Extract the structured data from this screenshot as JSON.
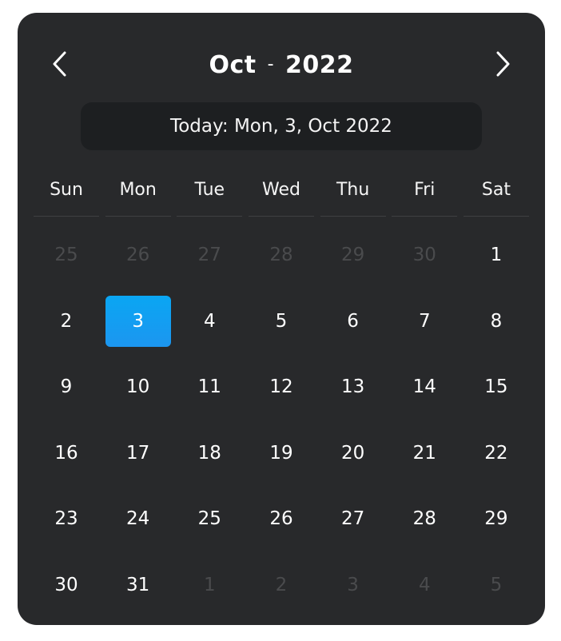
{
  "header": {
    "month": "Oct",
    "separator": "-",
    "year": "2022",
    "prev_icon": "chevron-left-icon",
    "next_icon": "chevron-right-icon"
  },
  "today_label": "Today: Mon, 3, Oct 2022",
  "weekdays": [
    "Sun",
    "Mon",
    "Tue",
    "Wed",
    "Thu",
    "Fri",
    "Sat"
  ],
  "days": [
    {
      "label": "25",
      "muted": true
    },
    {
      "label": "26",
      "muted": true
    },
    {
      "label": "27",
      "muted": true
    },
    {
      "label": "28",
      "muted": true
    },
    {
      "label": "29",
      "muted": true
    },
    {
      "label": "30",
      "muted": true
    },
    {
      "label": "1"
    },
    {
      "label": "2"
    },
    {
      "label": "3",
      "selected": true
    },
    {
      "label": "4"
    },
    {
      "label": "5"
    },
    {
      "label": "6"
    },
    {
      "label": "7"
    },
    {
      "label": "8"
    },
    {
      "label": "9"
    },
    {
      "label": "10"
    },
    {
      "label": "11"
    },
    {
      "label": "12"
    },
    {
      "label": "13"
    },
    {
      "label": "14"
    },
    {
      "label": "15"
    },
    {
      "label": "16"
    },
    {
      "label": "17"
    },
    {
      "label": "18"
    },
    {
      "label": "19"
    },
    {
      "label": "20"
    },
    {
      "label": "21"
    },
    {
      "label": "22"
    },
    {
      "label": "23"
    },
    {
      "label": "24"
    },
    {
      "label": "25"
    },
    {
      "label": "26"
    },
    {
      "label": "27"
    },
    {
      "label": "28"
    },
    {
      "label": "29"
    },
    {
      "label": "30"
    },
    {
      "label": "31"
    },
    {
      "label": "1",
      "muted": true
    },
    {
      "label": "2",
      "muted": true
    },
    {
      "label": "3",
      "muted": true
    },
    {
      "label": "4",
      "muted": true
    },
    {
      "label": "5",
      "muted": true
    }
  ],
  "colors": {
    "background": "#28292b",
    "today_bar": "#1d1f21",
    "selected": "#0aa6f3",
    "muted_text": "#4a4b4d"
  }
}
